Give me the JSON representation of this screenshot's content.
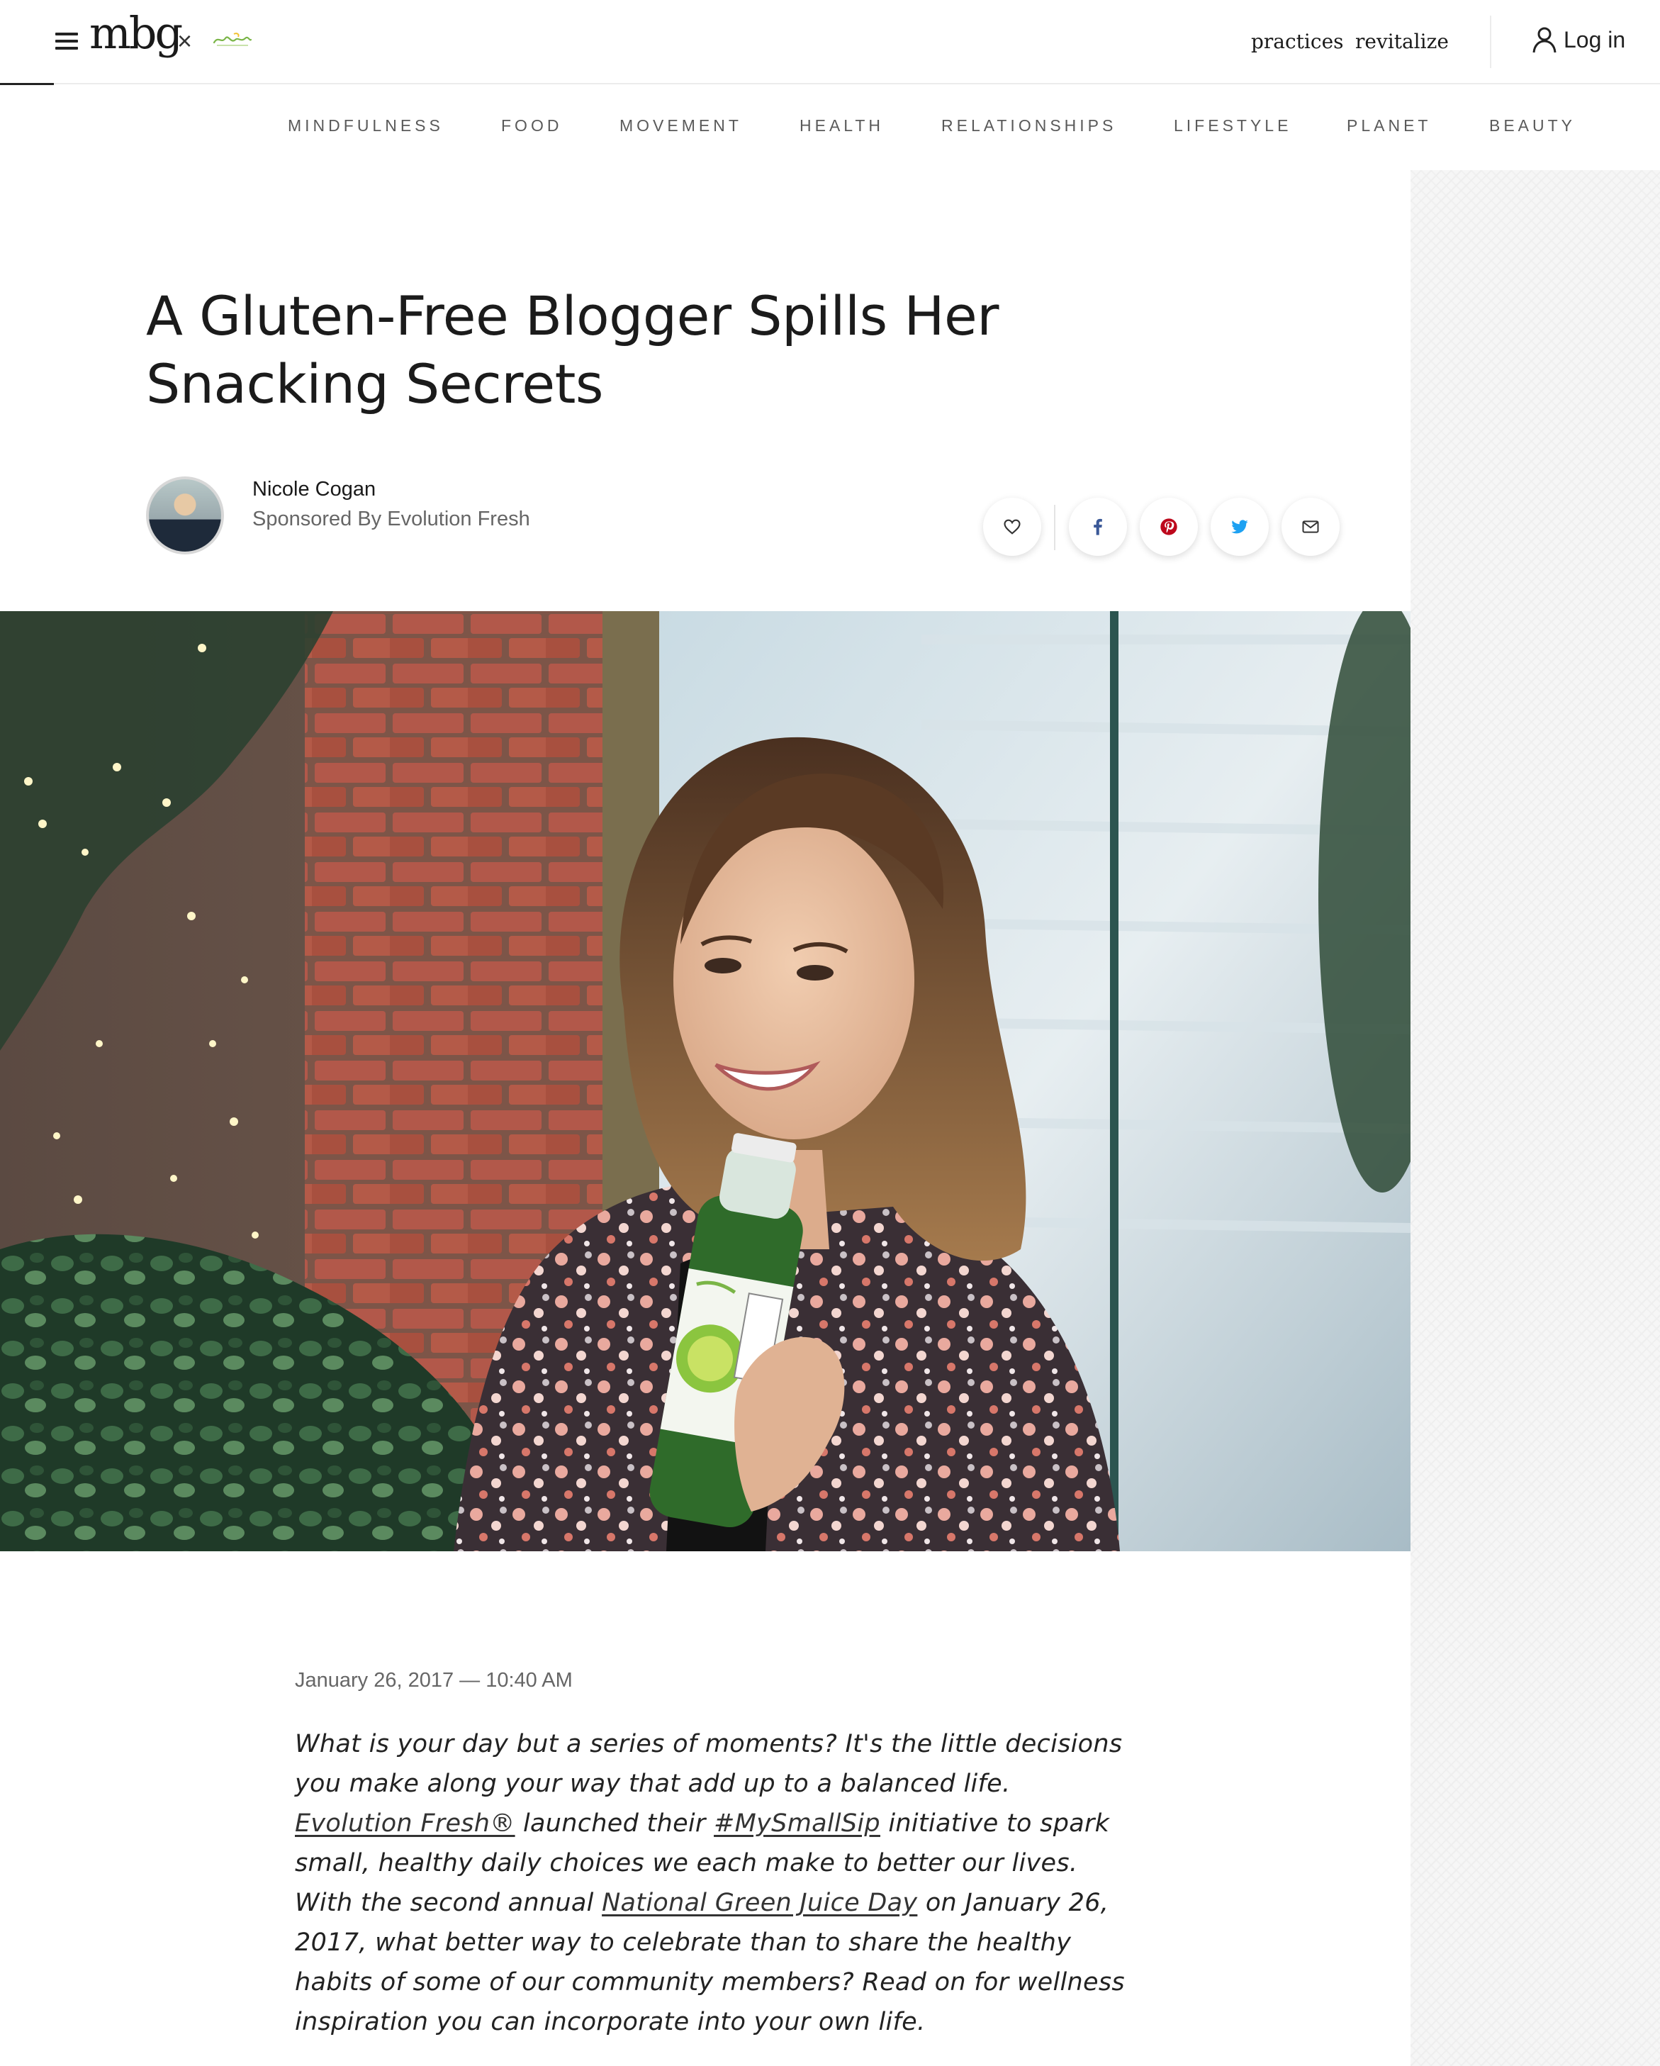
{
  "header": {
    "logo": "mbg",
    "separator": "×",
    "nav": [
      {
        "label": "practices"
      },
      {
        "label": "revitalize"
      }
    ],
    "login_label": "Log in"
  },
  "categories": [
    {
      "label": "MINDFULNESS"
    },
    {
      "label": "FOOD"
    },
    {
      "label": "MOVEMENT"
    },
    {
      "label": "HEALTH"
    },
    {
      "label": "RELATIONSHIPS"
    },
    {
      "label": "LIFESTYLE"
    },
    {
      "label": "PLANET"
    },
    {
      "label": "BEAUTY"
    }
  ],
  "article": {
    "title": "A Gluten-Free Blogger Spills Her Snacking Secrets",
    "author": "Nicole Cogan",
    "sponsor": "Sponsored By Evolution Fresh",
    "date": "January 26, 2017 — 10:40 AM",
    "intro": {
      "t1": "What is your day but a series of moments? It's the little decisions you make along your way that add up to a balanced life. ",
      "link1": "Evolution Fresh®",
      "t2": " launched their ",
      "link2": "#MySmallSip",
      "t3": " initiative to spark small, healthy daily choices we each make to better our lives. With the second annual ",
      "link3": "National Green Juice Day",
      "t4": " on January 26, 2017, what better way to celebrate than to share the healthy habits of some of our community members? Read on for wellness inspiration you can incorporate into your own life."
    }
  },
  "share_icons": [
    "heart-icon",
    "facebook-icon",
    "pinterest-icon",
    "twitter-icon",
    "email-icon"
  ],
  "colors": {
    "facebook": "#3b5998",
    "pinterest": "#bd081c",
    "twitter": "#1da1f2",
    "nav_text": "#5a5a5a",
    "partner_green": "#7ab547"
  }
}
